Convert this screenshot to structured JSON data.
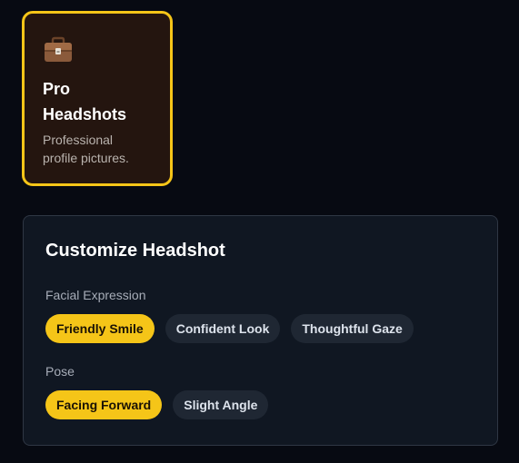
{
  "category_card": {
    "icon": "briefcase-icon",
    "title": "Pro Headshots",
    "description": "Professional profile pictures.",
    "selected": true
  },
  "customize": {
    "title": "Customize Headshot",
    "facial_expression": {
      "label": "Facial Expression",
      "options": [
        {
          "label": "Friendly Smile",
          "selected": true
        },
        {
          "label": "Confident Look",
          "selected": false
        },
        {
          "label": "Thoughtful Gaze",
          "selected": false
        }
      ]
    },
    "pose": {
      "label": "Pose",
      "options": [
        {
          "label": "Facing Forward",
          "selected": true
        },
        {
          "label": "Slight Angle",
          "selected": false
        }
      ]
    }
  },
  "colors": {
    "page_background": "#070a12",
    "accent": "#f5c518",
    "card_background": "#24150f",
    "panel_background": "#101722",
    "chip_background": "#1f2733"
  }
}
